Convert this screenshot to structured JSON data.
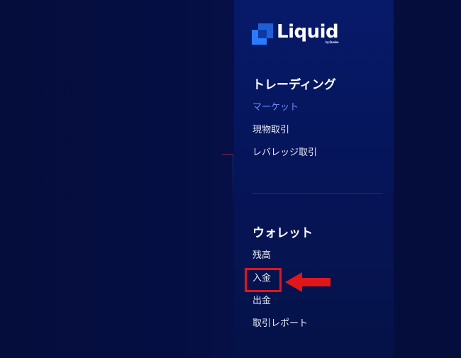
{
  "brand": {
    "name": "Liquid",
    "tagline": "by Quoine"
  },
  "sections": [
    {
      "title": "トレーディング",
      "items": [
        {
          "label": "マーケット",
          "active": true
        },
        {
          "label": "現物取引",
          "active": false
        },
        {
          "label": "レバレッジ取引",
          "active": false
        }
      ]
    },
    {
      "title": "ウォレット",
      "items": [
        {
          "label": "残高",
          "active": false
        },
        {
          "label": "入金",
          "active": false,
          "highlighted": true
        },
        {
          "label": "出金",
          "active": false
        },
        {
          "label": "取引レポート",
          "active": false
        }
      ]
    }
  ],
  "colors": {
    "active_item": "#6b8cff",
    "highlight": "#e0161b",
    "logo_blue": "#2a7bff",
    "sidebar_bg": "#071a6a"
  },
  "annotation": {
    "type": "red-arrow-pointing-left",
    "target": "入金"
  }
}
